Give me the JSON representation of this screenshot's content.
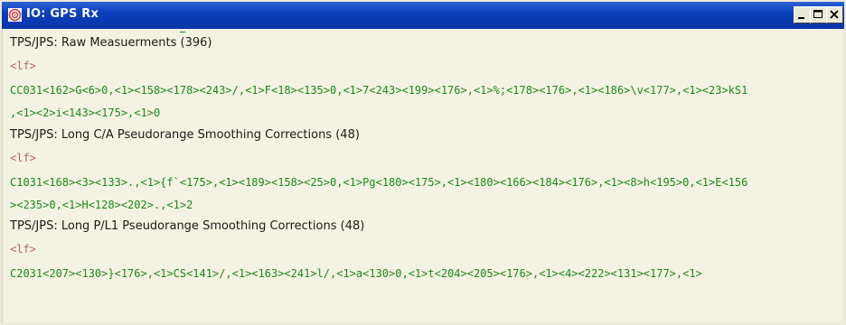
{
  "window": {
    "title": "IO: GPS Rx",
    "controls": [
      "minimize",
      "maximize",
      "close"
    ]
  },
  "colors": {
    "titlebar": "#0a3fbd",
    "content_bg": "#f4f2e2",
    "header_text": "#1b1b1b",
    "marker_text": "#b06565",
    "data_text": "#1a8a1a"
  },
  "log": {
    "lines": [
      {
        "type": "header",
        "text": "TPS/JPS: Raw Measuerments (396)"
      },
      {
        "type": "marker",
        "text": "<lf>"
      },
      {
        "type": "data",
        "text": "CC031<162>G<6>0,<1><158><178><243>/,<1>F<18><135>0,<1>7<243><199><176>,<1>%;<178><176>,<1><186>\\v<177>,<1><23>kS1"
      },
      {
        "type": "data",
        "text": ",<1><2>i<143><175>,<1>0"
      },
      {
        "type": "header",
        "text": "TPS/JPS: Long C/A Pseudorange Smoothing Corrections (48)"
      },
      {
        "type": "marker",
        "text": "<lf>"
      },
      {
        "type": "data",
        "text": "C1031<168><3><133>.,<1>{f`<175>,<1><189><158><25>0,<1>Pg<180><175>,<1><180><166><184><176>,<1><8>h<195>0,<1>E<156"
      },
      {
        "type": "data",
        "text": "><235>0,<1>H<128><202>.,<1>2"
      },
      {
        "type": "header",
        "text": "TPS/JPS: Long P/L1 Pseudorange Smoothing Corrections (48)"
      },
      {
        "type": "marker",
        "text": "<lf>"
      },
      {
        "type": "data",
        "text": "C2031<207><130>}<176>,<1>CS<141>/,<1><163><241>l/,<1>a<130>0,<1>t<204><205><176>,<1><4><222><131><177>,<1>"
      }
    ]
  }
}
